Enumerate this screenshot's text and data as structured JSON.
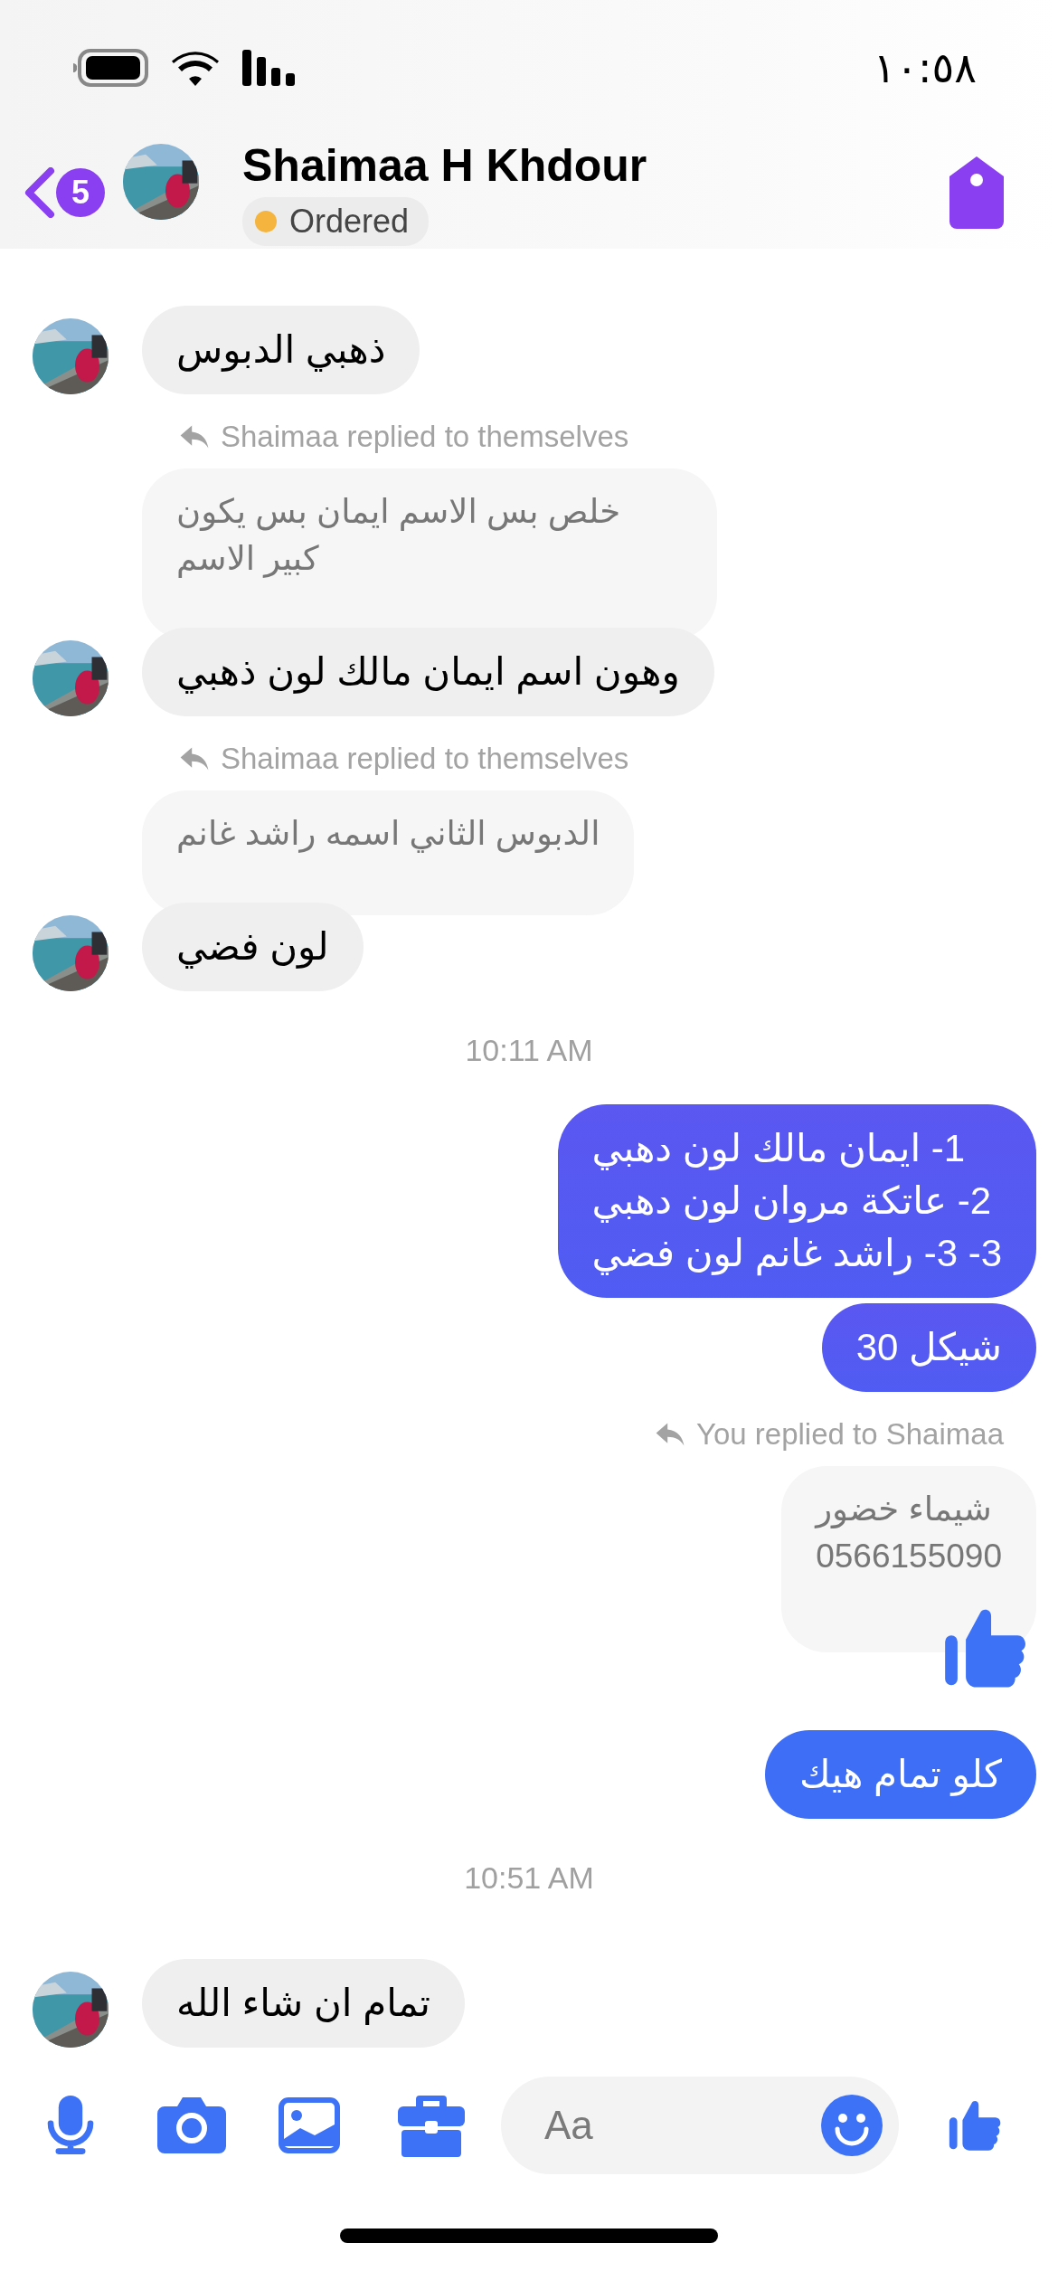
{
  "status_bar": {
    "time": "١٠:٥٨"
  },
  "header": {
    "back_count": "5",
    "name": "Shaimaa H Khdour",
    "status": {
      "label": "Ordered",
      "color": "#f4b43d"
    }
  },
  "messages": [
    {
      "kind": "incoming",
      "text": "ذهبي الدبوس",
      "avatar": true
    },
    {
      "kind": "incoming_note",
      "text": "Shaimaa replied to themselves"
    },
    {
      "kind": "incoming_quote",
      "text": "خلص بس الاسم ايمان بس يكون كبير الاسم"
    },
    {
      "kind": "incoming",
      "text": "وهون اسم ايمان مالك لون ذهبي",
      "avatar": true
    },
    {
      "kind": "incoming_note",
      "text": "Shaimaa replied to themselves"
    },
    {
      "kind": "incoming_quote",
      "text": "الدبوس الثاني اسمه راشد غانم"
    },
    {
      "kind": "incoming",
      "text": "لون فضي",
      "avatar": true
    },
    {
      "kind": "time",
      "text": "10:11 AM"
    },
    {
      "kind": "outgoing",
      "text": "1- ايمان مالك لون دهبي\n2- عاتكة مروان لون دهبي\n3- 3- راشد غانم لون فضي"
    },
    {
      "kind": "outgoing",
      "text": "شيكل 30"
    },
    {
      "kind": "outgoing_note",
      "text": "You replied to Shaimaa"
    },
    {
      "kind": "outgoing_quote",
      "text": "شيماء خضور\n0566155090"
    },
    {
      "kind": "like"
    },
    {
      "kind": "outgoing",
      "text": "كلو تمام هيك"
    },
    {
      "kind": "time",
      "text": "10:51 AM"
    },
    {
      "kind": "incoming",
      "text": "تمام ان شاء الله",
      "avatar": true
    }
  ],
  "composer": {
    "placeholder": "Aa"
  }
}
